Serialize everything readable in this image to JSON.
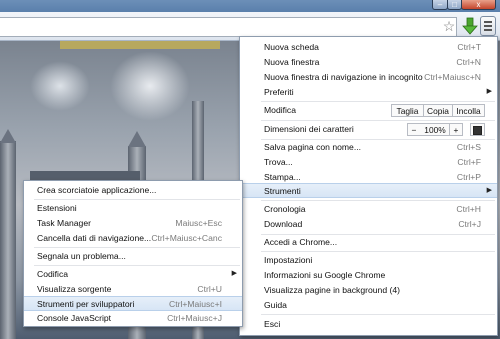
{
  "window": {
    "close_glyph": "x"
  },
  "toolbar": {
    "star_icon": "star-icon",
    "download_icon": "download-arrow-icon",
    "menu_icon": "wrench-menu-icon",
    "star_glyph": "☆"
  },
  "main_menu": {
    "items": [
      {
        "label": "Nuova scheda",
        "shortcut": "Ctrl+T"
      },
      {
        "label": "Nuova finestra",
        "shortcut": "Ctrl+N"
      },
      {
        "label": "Nuova finestra di navigazione in incognito",
        "shortcut": "Ctrl+Maiusc+N"
      },
      {
        "label": "Preferiti",
        "has_submenu": true
      },
      {
        "label": "Modifica",
        "buttons": [
          "Taglia",
          "Copia",
          "Incolla"
        ]
      },
      {
        "label": "Dimensioni dei caratteri",
        "zoom": {
          "minus": "−",
          "value": "100%",
          "plus": "+"
        }
      },
      {
        "label": "Salva pagina con nome...",
        "shortcut": "Ctrl+S"
      },
      {
        "label": "Trova...",
        "shortcut": "Ctrl+F"
      },
      {
        "label": "Stampa...",
        "shortcut": "Ctrl+P"
      },
      {
        "label": "Strumenti",
        "has_submenu": true,
        "highlighted": true
      },
      {
        "label": "Cronologia",
        "shortcut": "Ctrl+H"
      },
      {
        "label": "Download",
        "shortcut": "Ctrl+J"
      },
      {
        "label": "Accedi a Chrome..."
      },
      {
        "label": "Impostazioni"
      },
      {
        "label": "Informazioni su Google Chrome"
      },
      {
        "label": "Visualizza pagine in background (4)"
      },
      {
        "label": "Guida"
      },
      {
        "label": "Esci"
      }
    ]
  },
  "submenu": {
    "items": [
      {
        "label": "Crea scorciatoie applicazione..."
      },
      {
        "label": "Estensioni"
      },
      {
        "label": "Task Manager",
        "shortcut": "Maiusc+Esc"
      },
      {
        "label": "Cancella dati di navigazione...",
        "shortcut": "Ctrl+Maiusc+Canc"
      },
      {
        "label": "Segnala un problema..."
      },
      {
        "label": "Codifica",
        "has_submenu": true
      },
      {
        "label": "Visualizza sorgente",
        "shortcut": "Ctrl+U"
      },
      {
        "label": "Strumenti per sviluppatori",
        "shortcut": "Ctrl+Maiusc+I",
        "highlighted": true
      },
      {
        "label": "Console JavaScript",
        "shortcut": "Ctrl+Maiusc+J"
      }
    ]
  }
}
